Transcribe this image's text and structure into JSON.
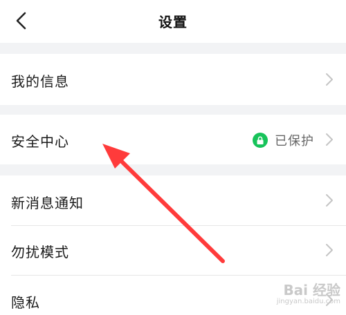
{
  "header": {
    "title": "设置",
    "back_icon": "chevron-left-icon"
  },
  "settings": {
    "my_info": "我的信息",
    "security_center": "安全中心",
    "security_status": "已保护",
    "new_message_notification": "新消息通知",
    "do_not_disturb": "勿扰模式",
    "privacy": "隐私"
  },
  "colors": {
    "status_green": "#17c35a",
    "annotation_red": "#ff3b3b",
    "chevron_gray": "#c4c4c4"
  },
  "watermark": {
    "logo": "Bai 经验",
    "url": "jingyan.baidu.com"
  }
}
